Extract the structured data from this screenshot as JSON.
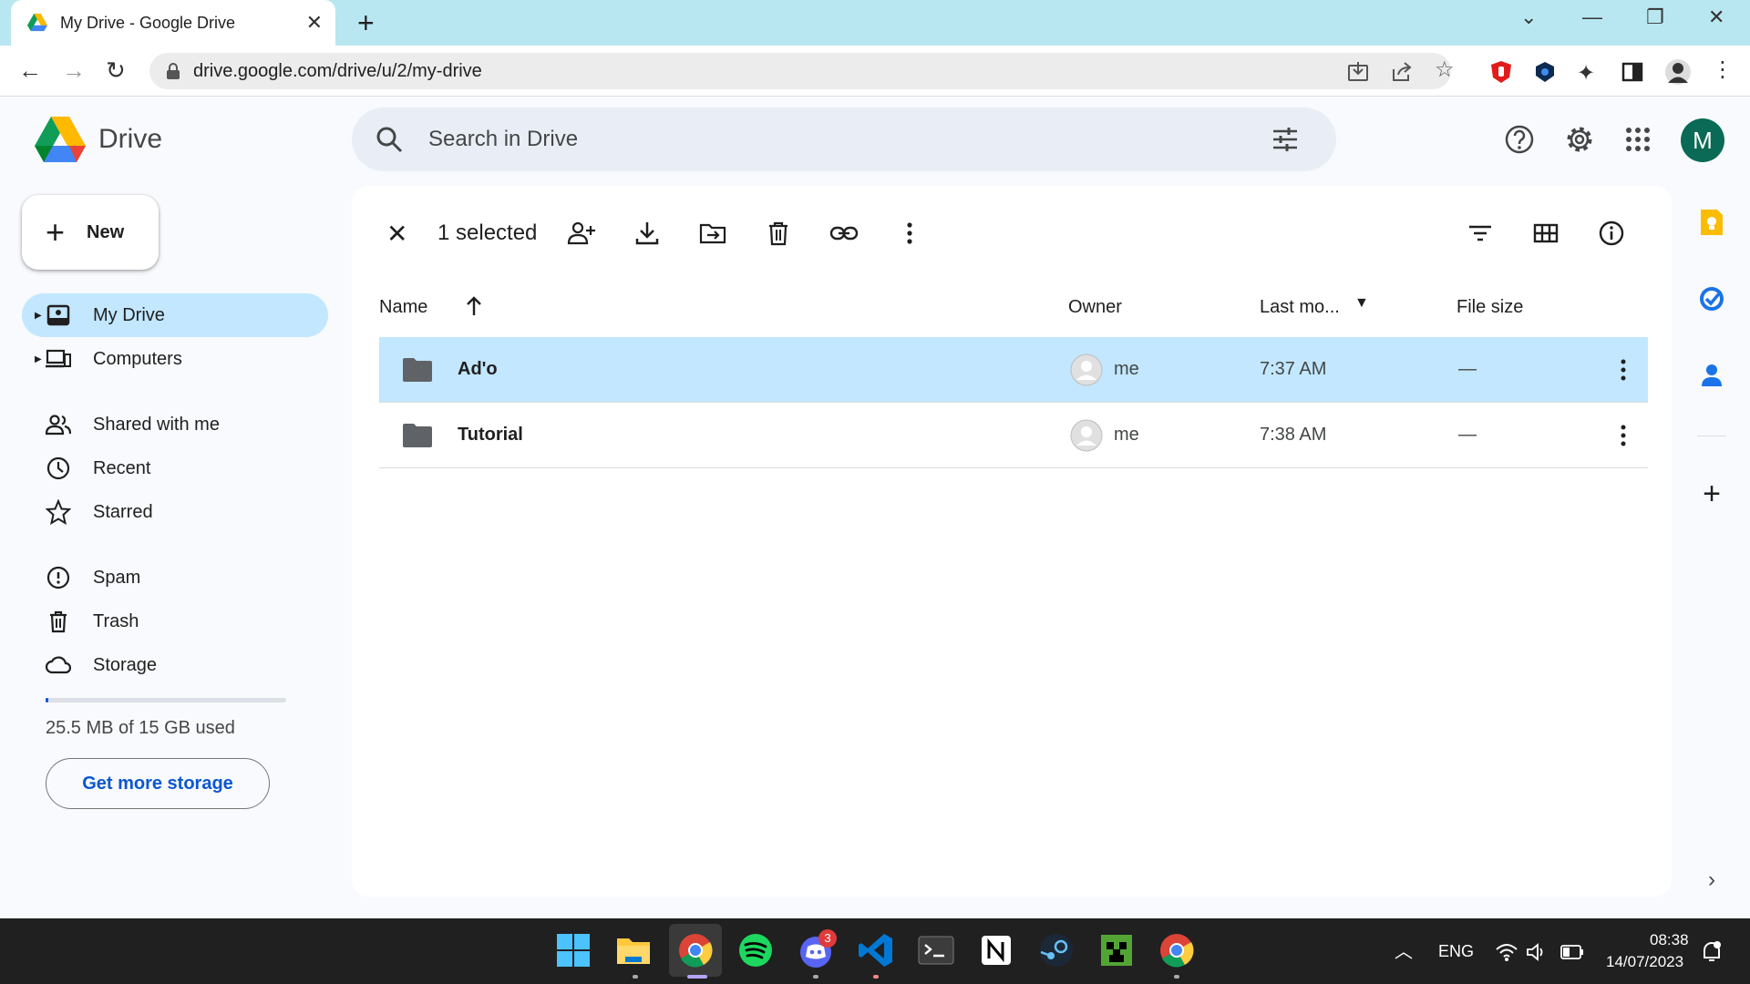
{
  "browser": {
    "tab_title": "My Drive - Google Drive",
    "url": "drive.google.com/drive/u/2/my-drive"
  },
  "drive": {
    "logo_text": "Drive",
    "search_placeholder": "Search in Drive",
    "avatar_letter": "M"
  },
  "sidebar": {
    "new_label": "New",
    "items": [
      {
        "label": "My Drive",
        "icon": "my-drive-icon",
        "active": true
      },
      {
        "label": "Computers",
        "icon": "computers-icon"
      },
      {
        "label": "Shared with me",
        "icon": "shared-icon"
      },
      {
        "label": "Recent",
        "icon": "clock-icon"
      },
      {
        "label": "Starred",
        "icon": "star-icon"
      },
      {
        "label": "Spam",
        "icon": "spam-icon"
      },
      {
        "label": "Trash",
        "icon": "trash-icon"
      },
      {
        "label": "Storage",
        "icon": "cloud-icon"
      }
    ],
    "storage_used": "25.5 MB of 15 GB used",
    "storage_fraction": 0.0017,
    "get_more_storage": "Get more storage"
  },
  "toolbar": {
    "selected_count": "1 selected"
  },
  "table": {
    "columns": [
      "Name",
      "Owner",
      "Last mo...",
      "File size"
    ],
    "rows": [
      {
        "name": "Ad'o",
        "owner": "me",
        "modified": "7:37 AM",
        "size": "—",
        "selected": true
      },
      {
        "name": "Tutorial",
        "owner": "me",
        "modified": "7:38 AM",
        "size": "—",
        "selected": false
      }
    ]
  },
  "taskbar": {
    "discord_badge": "3",
    "language": "ENG",
    "time": "08:38",
    "date": "14/07/2023"
  },
  "colors": {
    "selection": "#c2e7ff",
    "accent": "#0b57d0",
    "tab_strip": "#b9e7f1"
  }
}
